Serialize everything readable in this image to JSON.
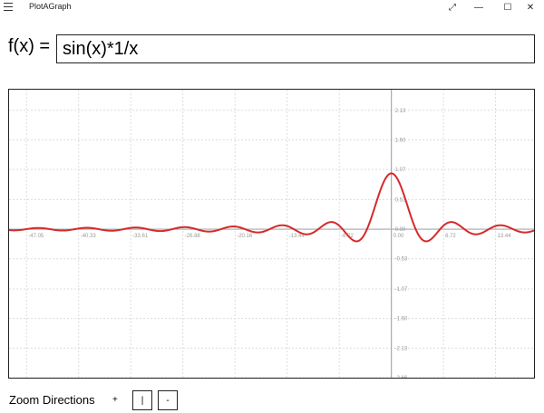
{
  "window": {
    "title": "PlotAGraph",
    "buttons": {
      "expand": "⤢",
      "minimize": "—",
      "maximize": "☐",
      "close": "✕"
    }
  },
  "function_bar": {
    "label": "f(x) =",
    "value": "sin(x)*1/x"
  },
  "controls": {
    "zoom_label": "Zoom Directions",
    "zoom_plus": "+",
    "vertical_button": "|",
    "horizontal_button": "-"
  },
  "colors": {
    "curve": "#d42a2a",
    "axis": "#aaaaaa",
    "grid": "#dcdcdc",
    "tick_text": "#999999"
  },
  "chart_data": {
    "type": "line",
    "function": "sin(x)*1/x",
    "xlim": [
      -49.3,
      18.4
    ],
    "ylim": [
      -2.66,
      2.5
    ],
    "x_ticks": [
      -47.05,
      -40.33,
      -33.61,
      -26.88,
      -20.16,
      -13.44,
      -6.72,
      0.0,
      6.72,
      13.44
    ],
    "x_tick_labels": [
      "-47.05",
      "-40.33",
      "-33.61",
      "-26.88",
      "-20.16",
      "-13.44",
      "-6.72",
      "0.00",
      "6.72",
      "13.44"
    ],
    "y_ticks": [
      2.13,
      1.6,
      1.07,
      0.53,
      0.0,
      -0.53,
      -1.07,
      -1.6,
      -2.13,
      -2.66
    ],
    "y_tick_labels": [
      "2.13",
      "1.60",
      "1.07",
      "0.53",
      "0.00",
      "-0.53",
      "-1.07",
      "-1.60",
      "-2.13",
      "-2.66"
    ],
    "grid": true
  }
}
